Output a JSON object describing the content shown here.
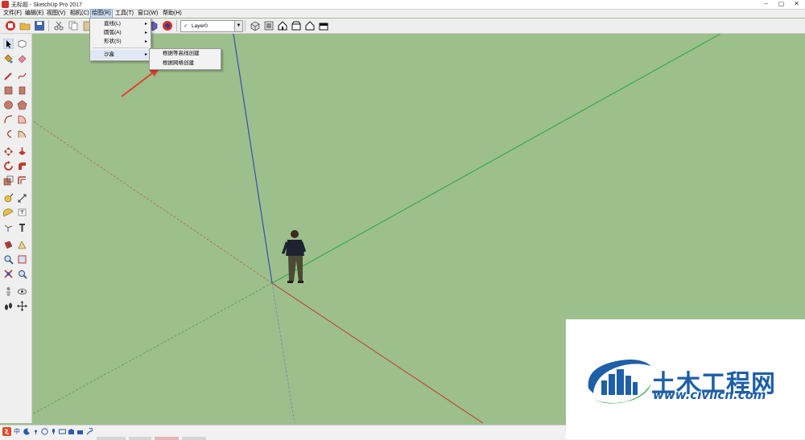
{
  "window": {
    "title": "无标题 - SketchUp Pro 2017",
    "minimize": "–",
    "maximize": "▢",
    "close": "✕"
  },
  "menubar": {
    "items": [
      "文件(F)",
      "编辑(E)",
      "视图(V)",
      "相机(C)",
      "绘图(R)",
      "工具(T)",
      "窗口(W)",
      "帮助(H)"
    ],
    "active_index": 4
  },
  "toolbar": {
    "layer_check": "✓",
    "layer_name": "Layer0",
    "layer_dropdown_arrow": "▼"
  },
  "draw_menu": {
    "items": [
      {
        "label": "直线(L)",
        "has_submenu": true
      },
      {
        "label": "圆弧(A)",
        "has_submenu": true
      },
      {
        "label": "形状(S)",
        "has_submenu": true
      },
      {
        "label": "沙盒",
        "has_submenu": true
      }
    ],
    "submenu_arrow": "▸",
    "sandbox_submenu": {
      "items": [
        "根据等高线创建",
        "根据网格创建"
      ]
    }
  },
  "scene": {
    "background": "#9dbf8c",
    "axis_colors": {
      "red": "#c0392b",
      "green": "#1fa83c",
      "blue": "#3a4fb0"
    },
    "annotation_arrow_color": "#e0402e",
    "human_figure": "scale-figure"
  },
  "icons": {
    "left_toolbar": [
      "select-arrow-icon",
      "component-icon",
      "paint-bucket-icon",
      "eraser-icon",
      "line-pencil-icon",
      "freehand-icon",
      "rectangle-icon",
      "rotated-rectangle-icon",
      "circle-icon",
      "polygon-icon",
      "arc-icon",
      "pie-icon",
      "move-icon",
      "push-pull-icon",
      "rotate-icon",
      "follow-me-icon",
      "scale-icon",
      "offset-icon",
      "tape-measure-icon",
      "dimension-icon",
      "protractor-icon",
      "text-icon",
      "axes-icon",
      "3d-text-icon",
      "section-plane-icon",
      "section-fill-icon",
      "zoom-icon",
      "zoom-window-icon",
      "zoom-extents-icon",
      "previous-view-icon",
      "position-camera-icon",
      "look-around-icon",
      "walk-icon",
      "orbit-icon"
    ]
  },
  "watermark": {
    "text_cn": "土木工程网",
    "url": "www.civilcn.com",
    "colors": {
      "blue": "#1e5fa8",
      "green": "#2fa84a"
    }
  },
  "statusbar": {
    "ime_label": "中"
  }
}
